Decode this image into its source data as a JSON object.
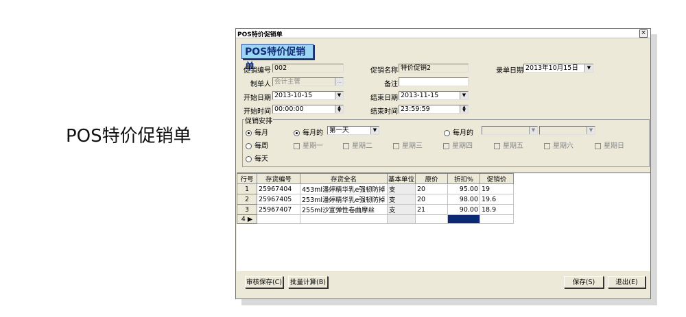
{
  "caption": "POS特价促销单",
  "window": {
    "title": "POS特价促销单",
    "close": "×",
    "banner": "POS特价促销单"
  },
  "form": {
    "promo_no_label": "促销编号",
    "promo_no": "002",
    "promo_name_label": "促销名称",
    "promo_name": "特价促销2",
    "entry_date_label": "录单日期",
    "entry_date": "2013年10月15日",
    "maker_label": "制单人",
    "maker": "会计主管",
    "remark_label": "备注",
    "remark": "",
    "start_date_label": "开始日期",
    "start_date": "2013-10-15",
    "end_date_label": "结束日期",
    "end_date": "2013-11-15",
    "start_time_label": "开始时间",
    "start_time": "00:00:00",
    "end_time_label": "结束时间",
    "end_time": "23:59:59"
  },
  "schedule": {
    "title": "促销安排",
    "monthly": "每月",
    "monthly_of": "每月的",
    "monthly_of_value": "第一天",
    "monthly_of2": "每月的",
    "weekly": "每周",
    "daily": "每天",
    "weekdays": [
      "星期一",
      "星期二",
      "星期三",
      "星期四",
      "星期五",
      "星期六",
      "星期日"
    ]
  },
  "grid": {
    "headers": [
      "行号",
      "存货编号",
      "存货全名",
      "基本单位",
      "原价",
      "折扣%",
      "促销价"
    ],
    "rows": [
      {
        "no": "1",
        "code": "25967404",
        "name": "453ml潘婷精华乳e强韧防掉",
        "unit": "支",
        "price": "20",
        "discount": "95.00",
        "promo": "19"
      },
      {
        "no": "2",
        "code": "25967405",
        "name": "253ml潘婷精华乳e强韧防掉",
        "unit": "支",
        "price": "20",
        "discount": "98.00",
        "promo": "19.6"
      },
      {
        "no": "3",
        "code": "25967407",
        "name": "255ml沙宣弹性卷曲摩丝",
        "unit": "支",
        "price": "21",
        "discount": "90.00",
        "promo": "18.9"
      },
      {
        "no": "4",
        "code": "",
        "name": "",
        "unit": "",
        "price": "",
        "discount": "",
        "promo": ""
      }
    ],
    "current_marker": "▶"
  },
  "buttons": {
    "audit_save": "审核保存(C)",
    "batch_calc": "批量计算(B)",
    "save": "保存(S)",
    "exit": "退出(E)"
  }
}
